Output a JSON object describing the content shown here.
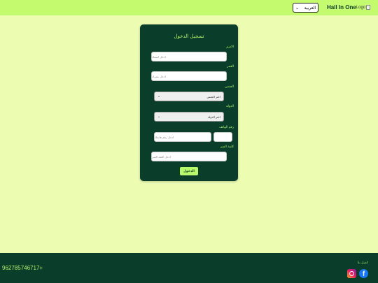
{
  "header": {
    "brand": "Hall In One",
    "logo_alt": "Logo",
    "language_selected": "العربية",
    "colors": {
      "bar": "#c4fb6e",
      "brand_text": "#0d3b2a"
    }
  },
  "form": {
    "title": "تسجيل الدخول",
    "name": {
      "label": "الاسم",
      "placeholder": "ادخل اسمك"
    },
    "age": {
      "label": "العمر",
      "placeholder": "ادخل عمرك"
    },
    "gender": {
      "label": "الجنس",
      "selected": "اختر الجنس"
    },
    "country": {
      "label": "الدولة",
      "selected": "اختر الدولة"
    },
    "phone": {
      "label": "رقم الهاتف",
      "placeholder": "ادخل رقم هاتفك",
      "code_value": ""
    },
    "password": {
      "label": "كلمة السر",
      "placeholder": "ادخل كلمة السر"
    },
    "submit_label": "الدخول",
    "colors": {
      "card": "#0a3d2a",
      "accent": "#b5f36c",
      "button": "#b9f96c"
    }
  },
  "footer": {
    "phone": "962785746717+",
    "contact_label": "اتصل بنا",
    "icons": [
      "instagram-icon",
      "facebook-icon"
    ],
    "fb_glyph": "f"
  },
  "icons": {
    "chevron": "⌄"
  }
}
